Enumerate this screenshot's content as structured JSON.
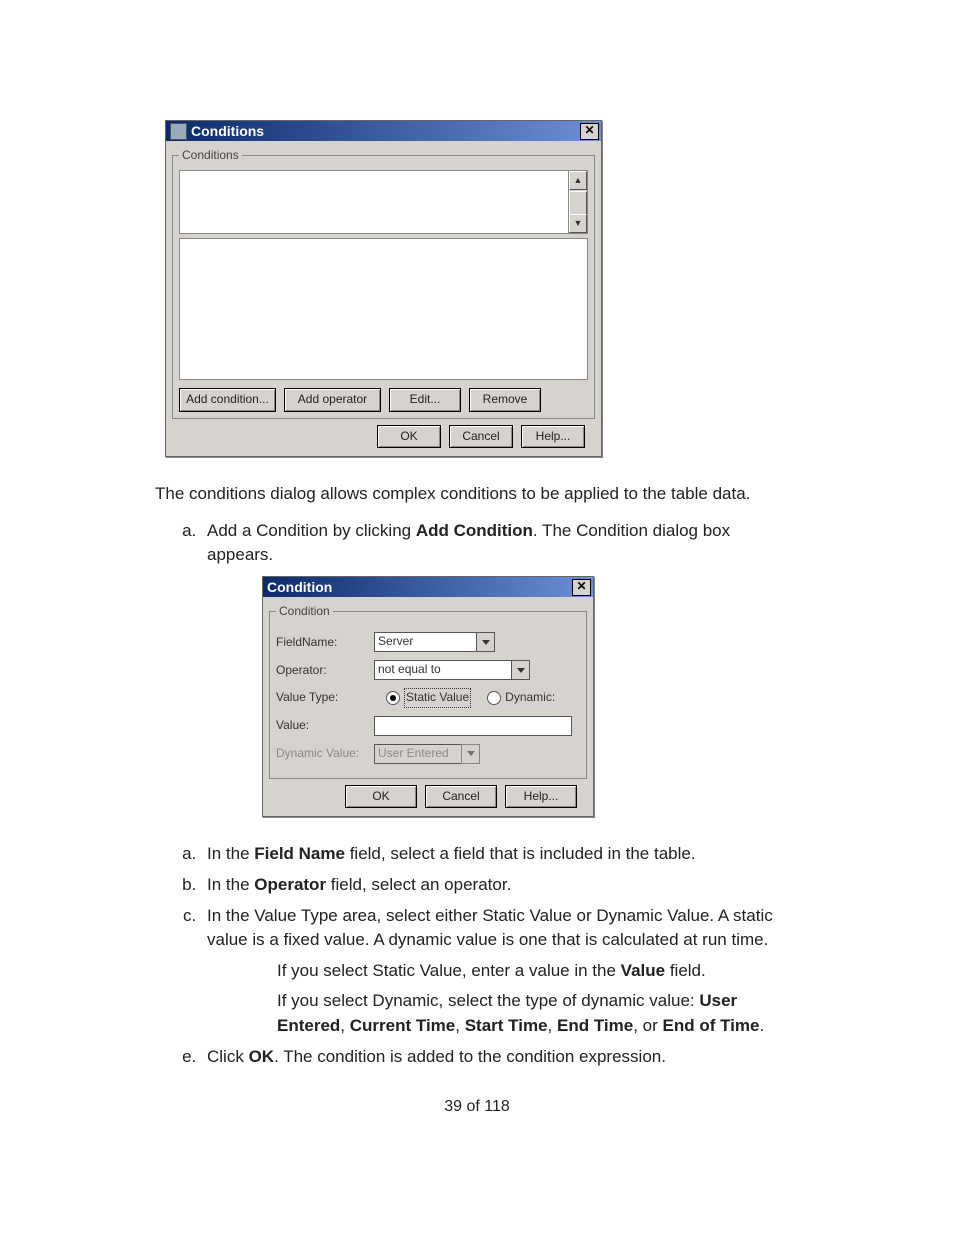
{
  "dialog1": {
    "title": "Conditions",
    "groupLabel": "Conditions",
    "buttons": {
      "addCondition": "Add condition...",
      "addOperator": "Add operator",
      "edit": "Edit...",
      "remove": "Remove",
      "ok": "OK",
      "cancel": "Cancel",
      "help": "Help..."
    }
  },
  "para1": "The conditions dialog allows complex conditions to be applied to the table data.",
  "step_a": {
    "pre": "Add a Condition by clicking ",
    "bold": "Add Condition",
    "post": ". The Condition dialog box appears."
  },
  "dialog2": {
    "title": "Condition",
    "groupLabel": "Condition",
    "labels": {
      "fieldName": "FieldName:",
      "operator": "Operator:",
      "valueType": "Value Type:",
      "value": "Value:",
      "dynamicValue": "Dynamic Value:"
    },
    "values": {
      "fieldName": "Server",
      "operator": "not equal to",
      "staticLabel": "Static Value",
      "dynamicLabel": "Dynamic:",
      "value": "",
      "dynamicValue": "User Entered"
    },
    "buttons": {
      "ok": "OK",
      "cancel": "Cancel",
      "help": "Help..."
    }
  },
  "step_a2": {
    "pre": "In the ",
    "bold": "Field Name",
    "post": " field, select a field that is included in the table."
  },
  "step_b": {
    "pre": "In the ",
    "bold": "Operator",
    "post": " field, select an operator."
  },
  "step_c": "In the Value Type area, select either Static Value or Dynamic Value. A static value is a fixed value. A dynamic value is one that is calculated at run time.",
  "sub1": {
    "pre": "If you select Static Value, enter a value in the ",
    "bold": "Value",
    "post": " field."
  },
  "sub2": {
    "pre": "If you select Dynamic, select the type of dynamic value: ",
    "b1": "User Entered",
    "s1": ", ",
    "b2": "Current Time",
    "s2": ", ",
    "b3": "Start Time",
    "s3": ", ",
    "b4": "End Time",
    "s4": ", or ",
    "b5": "End of Time",
    "s5": "."
  },
  "step_e": {
    "pre": "Click ",
    "bold": "OK",
    "post": ". The condition is added to the condition expression."
  },
  "pager": "39 of 118"
}
